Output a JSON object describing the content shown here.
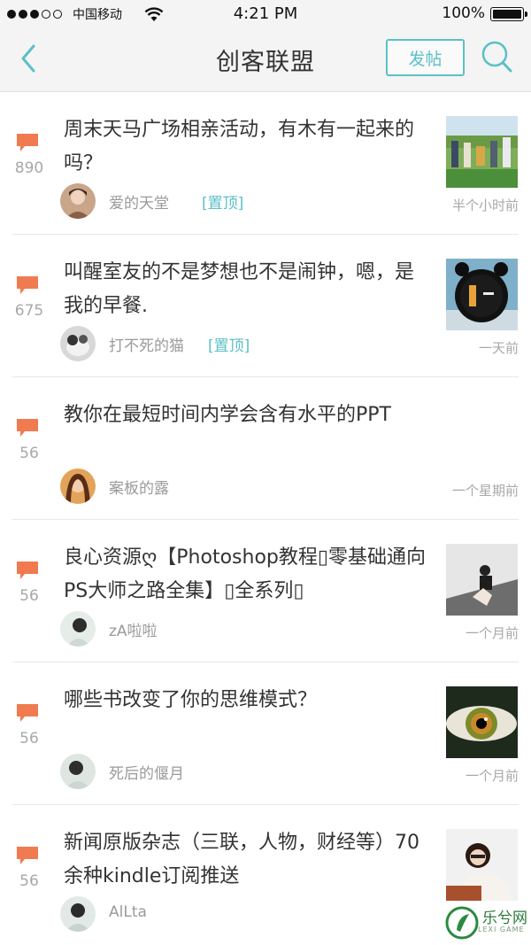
{
  "status_bar": {
    "carrier": "中国移动",
    "time": "4:21 PM",
    "battery": "100%"
  },
  "nav": {
    "title": "创客联盟",
    "post_label": "发帖"
  },
  "colors": {
    "accent": "#5bc0c6",
    "comment_icon": "#f07b50"
  },
  "posts": [
    {
      "title": "周末天马广场相亲活动，有木有一起来的吗？",
      "comments": "890",
      "author": "爱的天堂",
      "tag": "[置顶]",
      "time": "半个小时前",
      "has_thumb": true,
      "thumb_icon": "group-photo"
    },
    {
      "title": "叫醒室友的不是梦想也不是闹钟，嗯，是我的早餐.",
      "comments": "675",
      "author": "打不死的猫",
      "tag": "[置顶]",
      "time": "一天前",
      "has_thumb": true,
      "thumb_icon": "alarm-clock"
    },
    {
      "title": "教你在最短时间内学会含有水平的PPT",
      "comments": "56",
      "author": "案板的露",
      "tag": "",
      "time": "一个星期前",
      "has_thumb": false
    },
    {
      "title": "良心资源ღ【Photoshop教程▯零基础通向PS大师之路全集】▯全系列▯",
      "comments": "56",
      "author": "zA啦啦",
      "tag": "",
      "time": "一个月前",
      "has_thumb": true,
      "thumb_icon": "person-photo"
    },
    {
      "title": "哪些书改变了你的思维模式？",
      "comments": "56",
      "author": "死后的偃月",
      "tag": "",
      "time": "一个月前",
      "has_thumb": true,
      "thumb_icon": "eye-photo"
    },
    {
      "title": "新闻原版杂志（三联，人物，财经等）70余种kindle订阅推送",
      "comments": "56",
      "author": "AlLta",
      "tag": "",
      "time": "",
      "has_thumb": true,
      "thumb_icon": "portrait-photo"
    }
  ],
  "watermark": {
    "text": "乐兮网",
    "sub": "LEXI GAME"
  }
}
